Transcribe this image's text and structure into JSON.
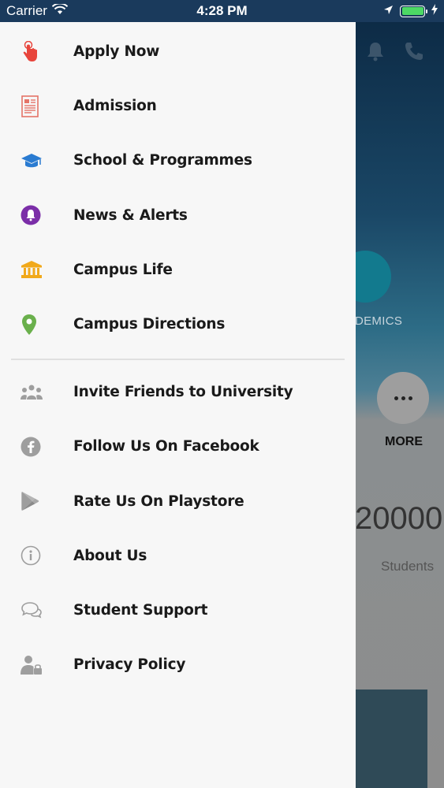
{
  "status_bar": {
    "carrier": "Carrier",
    "time": "4:28 PM",
    "battery_percent": 100
  },
  "background": {
    "academics_label": "DEMICS",
    "more_label": "MORE",
    "stat_value": "20000",
    "stat_label": "Students"
  },
  "drawer": {
    "primary_items": [
      {
        "label": "Apply Now",
        "icon": "hand-tap-icon"
      },
      {
        "label": "Admission",
        "icon": "document-icon"
      },
      {
        "label": "School & Programmes",
        "icon": "graduation-cap-icon"
      },
      {
        "label": "News & Alerts",
        "icon": "bell-icon"
      },
      {
        "label": "Campus Life",
        "icon": "institution-icon"
      },
      {
        "label": "Campus Directions",
        "icon": "map-pin-icon"
      }
    ],
    "secondary_items": [
      {
        "label": "Invite Friends to University",
        "icon": "people-icon"
      },
      {
        "label": "Follow Us On Facebook",
        "icon": "facebook-icon"
      },
      {
        "label": "Rate Us On Playstore",
        "icon": "playstore-icon"
      },
      {
        "label": "About Us",
        "icon": "info-icon"
      },
      {
        "label": "Student Support",
        "icon": "chat-icon"
      },
      {
        "label": "Privacy Policy",
        "icon": "user-lock-icon"
      }
    ]
  },
  "colors": {
    "apply": "#e8453c",
    "admission": "#e57368",
    "school": "#2a7bd1",
    "news": "#7b2ea8",
    "campus_life": "#f1a91b",
    "directions": "#6ab04c",
    "secondary": "#9e9e9e"
  }
}
